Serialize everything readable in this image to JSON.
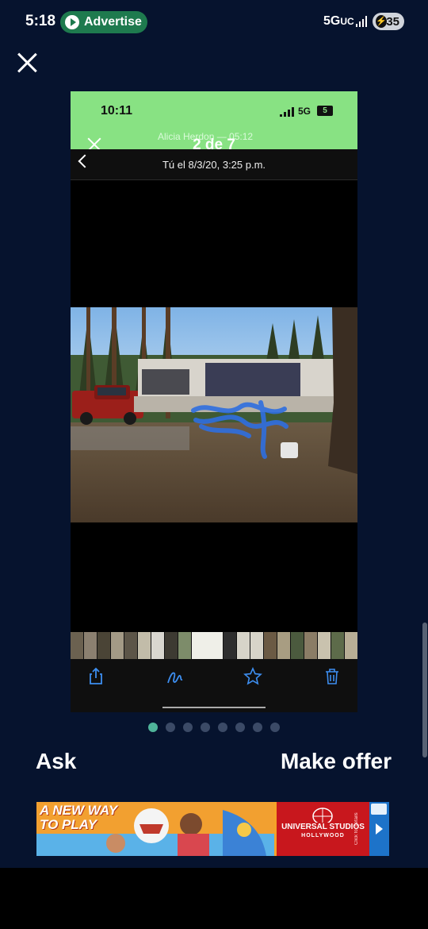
{
  "status_bar": {
    "time": "5:18",
    "pill_label": "Advertise",
    "network": "5G",
    "network_suffix": "UC",
    "battery": "35"
  },
  "viewer": {
    "inner_status": {
      "time": "10:11",
      "network": "5G",
      "battery": "5"
    },
    "call_banner": "Alicia Herdon — 05:12",
    "counter": "2 de 7",
    "date_line": "Tú el 8/3/20, 3:25 p.m.",
    "toolbar": [
      "share-icon",
      "markup-icon",
      "star-icon",
      "trash-icon"
    ]
  },
  "pager": {
    "count": 8,
    "active_index": 0
  },
  "actions": {
    "ask": "Ask",
    "offer": "Make offer"
  },
  "ad": {
    "headline_1": "A NEW WAY",
    "headline_2": "TO PLAY",
    "brand_1": "UNIVERSAL STUDIOS",
    "brand_2": "HOLLYWOOD",
    "click_text": "Click for details"
  },
  "colors": {
    "background": "#06132e",
    "green_banner": "#88e283",
    "dot_active": "#4fb49a",
    "ad_red": "#c8171d"
  }
}
